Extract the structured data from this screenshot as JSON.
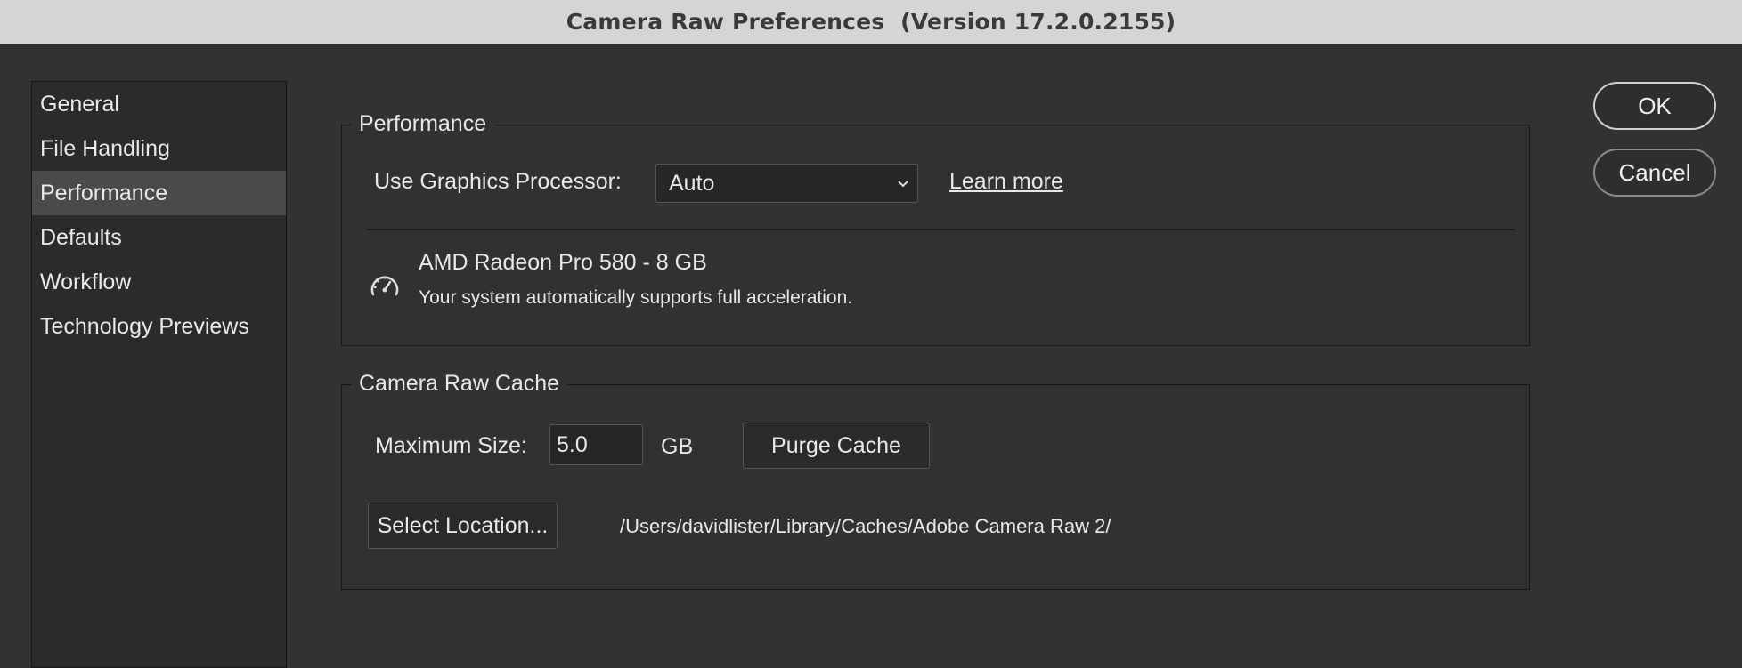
{
  "window": {
    "title": "Camera Raw Preferences  (Version 17.2.0.2155)"
  },
  "sidebar": {
    "items": [
      {
        "label": "General"
      },
      {
        "label": "File Handling"
      },
      {
        "label": "Performance",
        "active": true
      },
      {
        "label": "Defaults"
      },
      {
        "label": "Workflow"
      },
      {
        "label": "Technology Previews"
      }
    ]
  },
  "performance": {
    "legend": "Performance",
    "gpu_label": "Use Graphics Processor:",
    "gpu_select_value": "Auto",
    "learn_more": "Learn more",
    "gpu_name": "AMD Radeon Pro 580 - 8 GB",
    "gpu_status": "Your system automatically supports full acceleration.",
    "gauge_icon": "speedometer-icon"
  },
  "cache": {
    "legend": "Camera Raw Cache",
    "max_size_label": "Maximum Size:",
    "max_size_value": "5.0",
    "unit": "GB",
    "purge_button": "Purge Cache",
    "select_location_button": "Select Location...",
    "path": "/Users/davidlister/Library/Caches/Adobe Camera Raw 2/"
  },
  "buttons": {
    "ok": "OK",
    "cancel": "Cancel"
  }
}
